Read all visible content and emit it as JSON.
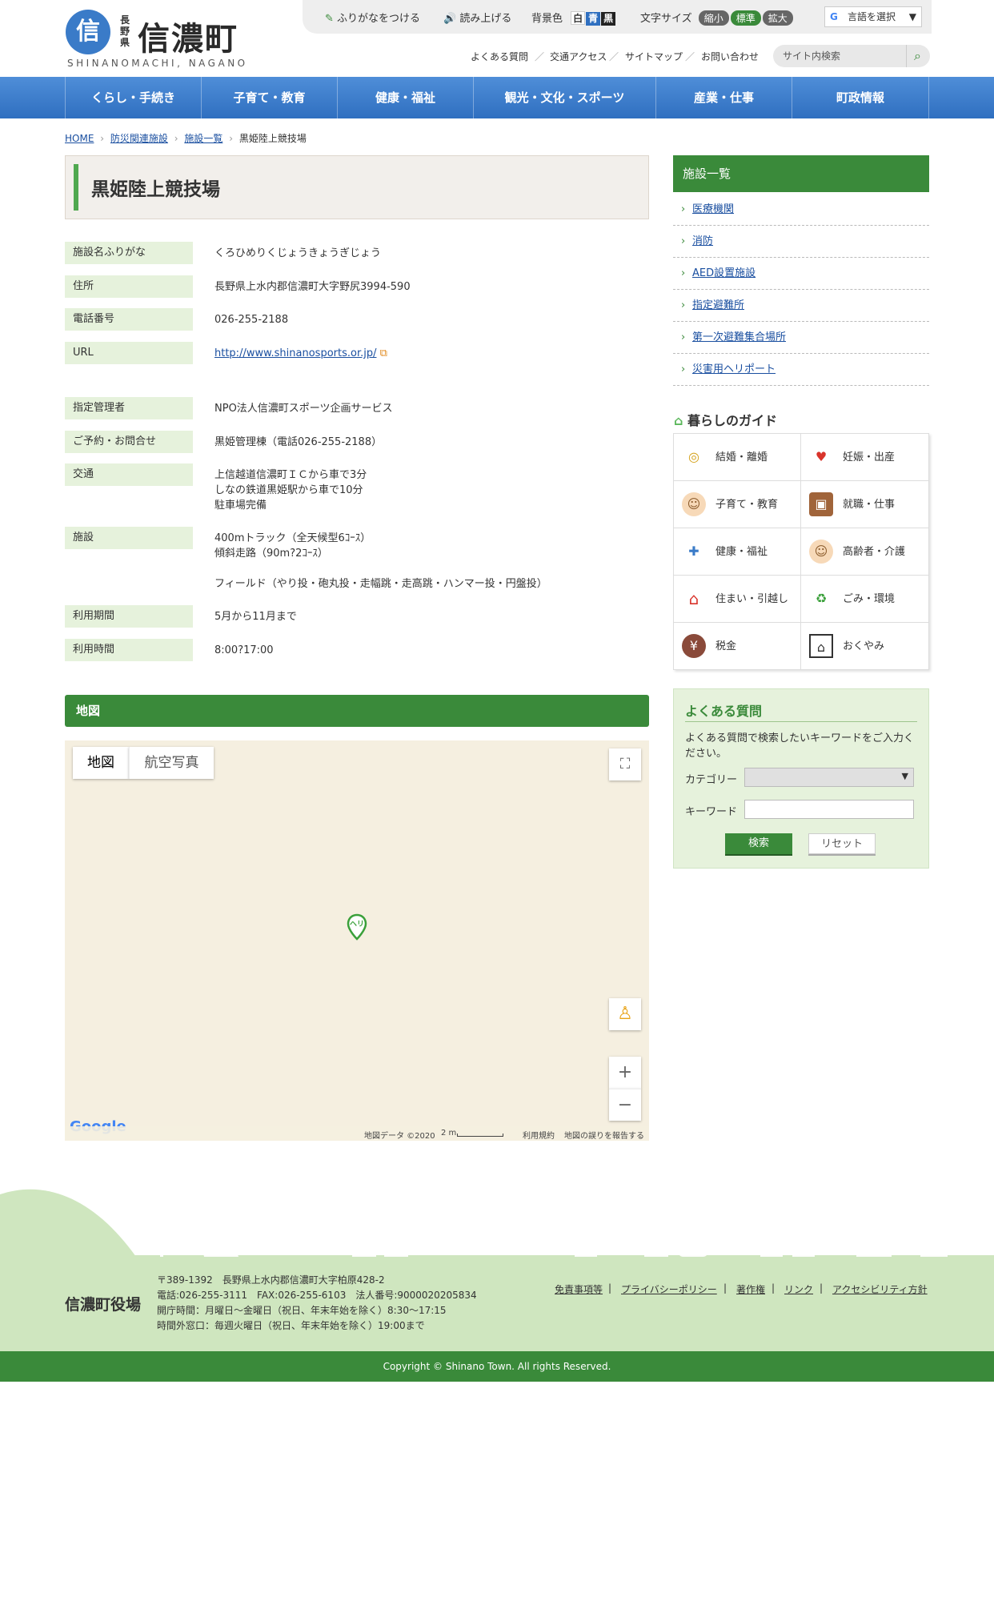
{
  "logo": {
    "mark": "信",
    "prefecture": "長野県",
    "name": "信濃町",
    "roman": "SHINANOMACHI, NAGANO"
  },
  "toolbar": {
    "furigana": "ふりがなをつける",
    "read_aloud": "読み上げる",
    "bg_color_label": "背景色",
    "bg_options": [
      "白",
      "青",
      "黒"
    ],
    "font_size_label": "文字サイズ",
    "font_sizes": [
      "縮小",
      "標準",
      "拡大"
    ],
    "language": "言語を選択"
  },
  "subnav": [
    "よくある質問",
    "交通アクセス",
    "サイトマップ",
    "お問い合わせ"
  ],
  "search": {
    "placeholder": "サイト内検索"
  },
  "mainnav": [
    "くらし・手続き",
    "子育て・教育",
    "健康・福祉",
    "観光・文化・スポーツ",
    "産業・仕事",
    "町政情報"
  ],
  "breadcrumb": [
    "HOME",
    "防災関連施設",
    "施設一覧",
    "黒姫陸上競技場"
  ],
  "page_title": "黒姫陸上競技場",
  "info": [
    {
      "label": "施設名ふりがな",
      "value": "くろひめりくじょうきょうぎじょう"
    },
    {
      "label": "住所",
      "value": "長野県上水内郡信濃町大字野尻3994-590"
    },
    {
      "label": "電話番号",
      "value": "026-255-2188"
    },
    {
      "label": "URL",
      "value": "http://www.shinanosports.or.jp/"
    },
    {
      "label": "指定管理者",
      "value": "NPO法人信濃町スポーツ企画サービス"
    },
    {
      "label": "ご予約・お問合せ",
      "value": "黒姫管理棟（電話026-255-2188）"
    },
    {
      "label": "交通",
      "value": "上信越道信濃町ＩＣから車で3分\nしなの鉄道黒姫駅から車で10分\n駐車場完備"
    },
    {
      "label": "施設",
      "value": "400mトラック（全天候型6ｺｰｽ）\n傾斜走路（90m?2ｺｰｽ）\n\nフィールド（やり投・砲丸投・走幅跳・走高跳・ハンマー投・円盤投）"
    },
    {
      "label": "利用期間",
      "value": "5月から11月まで"
    },
    {
      "label": "利用時間",
      "value": "8:00?17:00"
    }
  ],
  "map": {
    "heading": "地図",
    "tabs": [
      "地図",
      "航空写真"
    ],
    "marker": "ヘリ",
    "google": "Google",
    "attribution": "地図データ ©2020",
    "scale": "2 m",
    "terms": "利用規約",
    "report": "地図の誤りを報告する"
  },
  "sidebar": {
    "heading": "施設一覧",
    "items": [
      "医療機関",
      "消防",
      "AED設置施設",
      "指定避難所",
      "第一次避難集合場所",
      "災害用ヘリポート"
    ]
  },
  "guide": {
    "heading": "暮らしのガイド",
    "items": [
      {
        "label": "結婚・離婚",
        "icon": "rings-icon"
      },
      {
        "label": "妊娠・出産",
        "icon": "heart-hands-icon"
      },
      {
        "label": "子育て・教育",
        "icon": "baby-icon"
      },
      {
        "label": "就職・仕事",
        "icon": "briefcase-icon"
      },
      {
        "label": "健康・福祉",
        "icon": "hospital-icon"
      },
      {
        "label": "高齢者・介護",
        "icon": "elder-icon"
      },
      {
        "label": "住まい・引越し",
        "icon": "house-icon"
      },
      {
        "label": "ごみ・環境",
        "icon": "recycle-icon"
      },
      {
        "label": "税金",
        "icon": "purse-icon"
      },
      {
        "label": "おくやみ",
        "icon": "frame-icon"
      }
    ]
  },
  "faq": {
    "title": "よくある質問",
    "description": "よくある質問で検索したいキーワードをご入力ください。",
    "category_label": "カテゴリー",
    "keyword_label": "キーワード",
    "search_button": "検索",
    "reset_button": "リセット"
  },
  "footer": {
    "office": "信濃町役場",
    "address": "〒389-1392　長野県上水内郡信濃町大字柏原428-2\n電話:026-255-3111　FAX:026-255-6103　法人番号:9000020205834\n開庁時間：月曜日～金曜日（祝日、年末年始を除く）8:30～17:15\n時間外窓口：毎週火曜日（祝日、年末年始を除く）19:00まで",
    "links": [
      "免責事項等",
      "プライバシーポリシー",
      "著作権",
      "リンク",
      "アクセシビリティ方針"
    ],
    "copyright": "Copyright © Shinano Town. All rights Reserved."
  },
  "colors": {
    "brand_blue": "#3a7bc8",
    "brand_green": "#3a8a3a",
    "light_green": "#e6f2dc"
  }
}
